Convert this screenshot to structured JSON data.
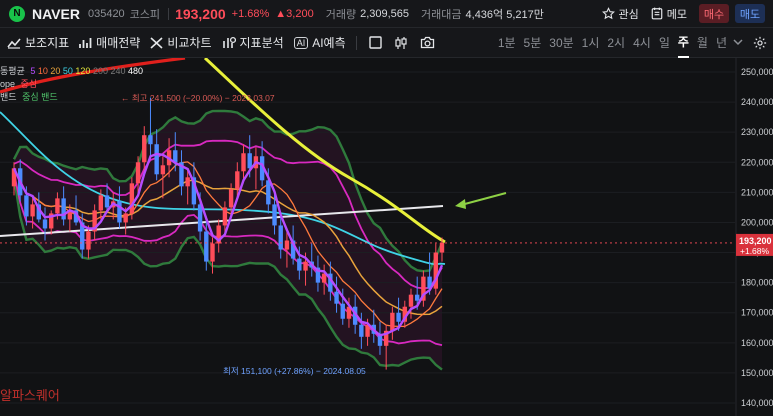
{
  "header": {
    "logo_letter": "N",
    "name": "NAVER",
    "code": "035420",
    "market": "코스피",
    "price": "193,200",
    "change_pct": "+1.68%",
    "change": "▲3,200",
    "volume_label": "거래량",
    "volume": "2,309,565",
    "amount_label": "거래대금",
    "amount": "4,436억 5,217만",
    "interest_label": "관심",
    "memo_label": "메모",
    "buy_label": "매수",
    "sell_label": "매도"
  },
  "toolbar": {
    "indicators_label": "보조지표",
    "strategy_label": "매매전략",
    "compare_label": "비교차트",
    "analysis_label": "지표분석",
    "ai_badge": "AI",
    "ai_label": "AI예측",
    "periods": [
      "1분",
      "5분",
      "30분",
      "1시",
      "2시",
      "4시",
      "일",
      "주",
      "월",
      "년"
    ],
    "active_period": "주"
  },
  "legend": {
    "ma_label": "동평균",
    "ma_periods": [
      {
        "text": "5",
        "color": "#b64cff"
      },
      {
        "text": "10",
        "color": "#ff6b3d"
      },
      {
        "text": "20",
        "color": "#e8a33c"
      },
      {
        "text": "50",
        "color": "#3fd3e6"
      },
      {
        "text": "120",
        "color": "#e3e63a"
      },
      {
        "text": "200",
        "color": "#7a7a7a"
      },
      {
        "text": "240",
        "color": "#7a7a7a"
      },
      {
        "text": "480",
        "color": "#ffffff"
      }
    ],
    "envelope_label": "ope",
    "envelope_text": "중심",
    "band_label": "밴드",
    "band_text": "중심 밴드"
  },
  "annotations": {
    "high": "← 최고 241,500 (−20.00%) − 2023.03.07",
    "low": "최저 151,100 (+27.86%) − 2024.08.05"
  },
  "watermark": "알파스퀘어",
  "price_tag": {
    "price": "193,200",
    "pct": "+1.68%"
  },
  "colors": {
    "up": "#ff4d5a",
    "down": "#4d8bff",
    "accent_yellow": "#e8f03a",
    "arrow": "#8ed145"
  },
  "chart_data": {
    "type": "candlestick",
    "y_axis_ticks": [
      "250,000",
      "240,000",
      "230,000",
      "220,000",
      "210,000",
      "200,000",
      "190,000",
      "180,000",
      "170,000",
      "160,000",
      "150,000",
      "140,000"
    ],
    "ylim": [
      140000,
      252000
    ],
    "current_price": 193200,
    "high_marker": 241500,
    "low_marker": 151100,
    "candles": [
      [
        212000,
        220000,
        209000,
        218000
      ],
      [
        218000,
        221000,
        207000,
        209000
      ],
      [
        209000,
        212000,
        199000,
        202000
      ],
      [
        202000,
        208000,
        198000,
        206000
      ],
      [
        206000,
        210000,
        200000,
        201000
      ],
      [
        201000,
        205000,
        194000,
        198000
      ],
      [
        198000,
        204000,
        196000,
        203000
      ],
      [
        203000,
        210000,
        201000,
        208000
      ],
      [
        208000,
        212000,
        199000,
        201000
      ],
      [
        201000,
        206000,
        197000,
        204000
      ],
      [
        204000,
        209000,
        199000,
        200000
      ],
      [
        200000,
        203000,
        188000,
        191000
      ],
      [
        191000,
        199000,
        188000,
        197000
      ],
      [
        197000,
        206000,
        194000,
        204000
      ],
      [
        204000,
        211000,
        201000,
        209000
      ],
      [
        209000,
        213000,
        203000,
        205000
      ],
      [
        205000,
        210000,
        201000,
        207000
      ],
      [
        207000,
        212000,
        198000,
        200000
      ],
      [
        200000,
        205000,
        196000,
        203000
      ],
      [
        203000,
        215000,
        201000,
        213000
      ],
      [
        213000,
        222000,
        209000,
        220000
      ],
      [
        220000,
        232000,
        216000,
        229000
      ],
      [
        229000,
        241500,
        222000,
        226000
      ],
      [
        226000,
        231000,
        214000,
        216000
      ],
      [
        216000,
        222000,
        208000,
        219000
      ],
      [
        219000,
        228000,
        215000,
        224000
      ],
      [
        224000,
        230000,
        217000,
        220000
      ],
      [
        220000,
        224000,
        209000,
        212000
      ],
      [
        212000,
        218000,
        206000,
        215000
      ],
      [
        215000,
        220000,
        204000,
        206000
      ],
      [
        206000,
        210000,
        194000,
        197000
      ],
      [
        197000,
        202000,
        184000,
        187000
      ],
      [
        187000,
        195000,
        183000,
        193000
      ],
      [
        193000,
        201000,
        190000,
        199000
      ],
      [
        199000,
        207000,
        196000,
        205000
      ],
      [
        205000,
        213000,
        202000,
        211000
      ],
      [
        211000,
        220000,
        208000,
        217000
      ],
      [
        217000,
        226000,
        214000,
        223000
      ],
      [
        223000,
        229000,
        215000,
        218000
      ],
      [
        218000,
        225000,
        211000,
        222000
      ],
      [
        222000,
        227000,
        212000,
        214000
      ],
      [
        214000,
        218000,
        203000,
        206000
      ],
      [
        206000,
        210000,
        196000,
        199000
      ],
      [
        199000,
        203000,
        188000,
        191000
      ],
      [
        191000,
        197000,
        185000,
        194000
      ],
      [
        194000,
        199000,
        186000,
        188000
      ],
      [
        188000,
        192000,
        181000,
        184000
      ],
      [
        184000,
        190000,
        179000,
        187000
      ],
      [
        187000,
        193000,
        182000,
        185000
      ],
      [
        185000,
        189000,
        177000,
        180000
      ],
      [
        180000,
        186000,
        176000,
        183000
      ],
      [
        183000,
        187000,
        174000,
        177000
      ],
      [
        177000,
        182000,
        170000,
        173000
      ],
      [
        173000,
        178000,
        166000,
        168000
      ],
      [
        168000,
        175000,
        165000,
        172000
      ],
      [
        172000,
        176000,
        163000,
        166000
      ],
      [
        166000,
        170000,
        158000,
        162000
      ],
      [
        162000,
        168000,
        159000,
        166000
      ],
      [
        166000,
        171000,
        160000,
        163000
      ],
      [
        163000,
        167000,
        156000,
        159000
      ],
      [
        159000,
        166000,
        151100,
        164000
      ],
      [
        164000,
        172000,
        161000,
        170000
      ],
      [
        170000,
        175000,
        164000,
        167000
      ],
      [
        167000,
        174000,
        165000,
        172000
      ],
      [
        172000,
        178000,
        168000,
        176000
      ],
      [
        176000,
        182000,
        171000,
        174000
      ],
      [
        174000,
        184000,
        172000,
        182000
      ],
      [
        182000,
        190000,
        176000,
        178000
      ],
      [
        178000,
        193000,
        176000,
        190000
      ],
      [
        190000,
        195000,
        187000,
        193200
      ]
    ]
  }
}
